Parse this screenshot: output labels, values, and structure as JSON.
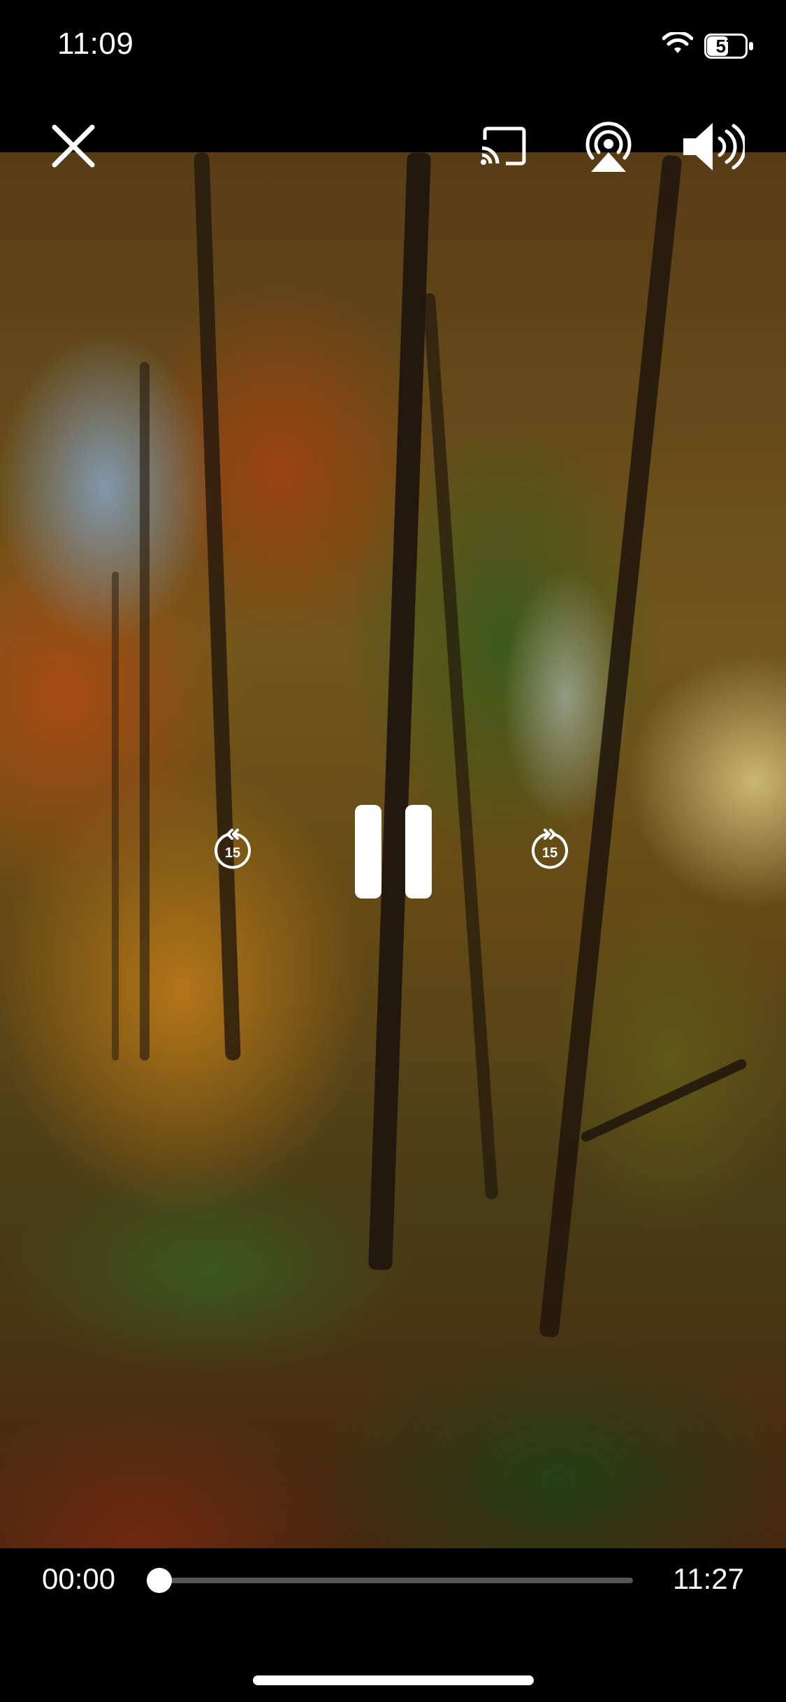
{
  "status_bar": {
    "time": "11:09",
    "battery_level": "57"
  },
  "top_controls": {
    "close_icon": "close-icon",
    "cast_icon": "cast-icon",
    "airplay_icon": "airplay-icon",
    "volume_icon": "volume-icon"
  },
  "player": {
    "rewind_label": "15",
    "forward_label": "15",
    "pause_icon": "pause-icon",
    "elapsed": "00:00",
    "duration": "11:27",
    "progress": 0
  },
  "colors": {
    "accent": "#ffffff",
    "background": "#000000",
    "track": "#555555"
  }
}
